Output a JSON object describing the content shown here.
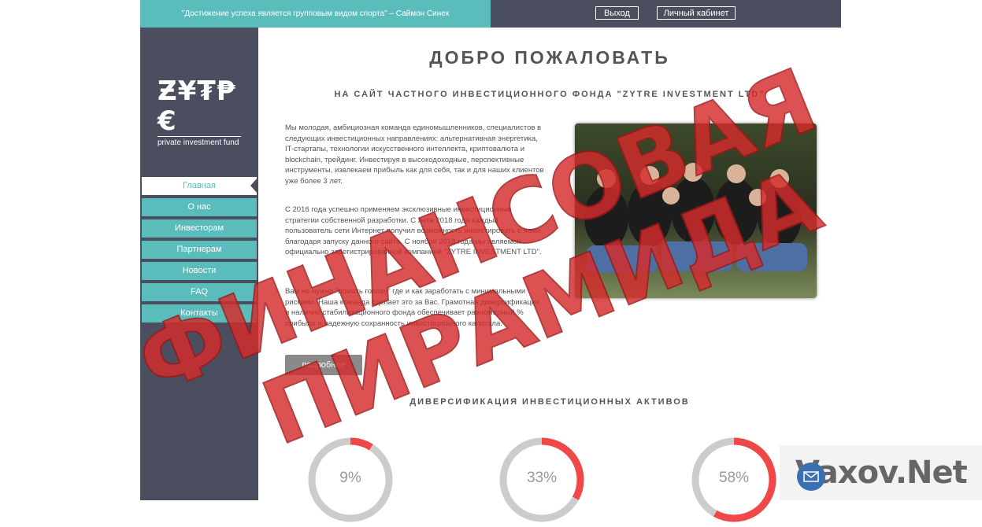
{
  "topbar": {
    "quote": "\"Достижение успеха является групповым видом спорта\" – Саймон Синек",
    "logout_label": "Выход",
    "cabinet_label": "Личный кабинет"
  },
  "logo": {
    "main": "ZYTRE",
    "sub": "private investment fund"
  },
  "nav": [
    {
      "label": "Главная"
    },
    {
      "label": "О нас"
    },
    {
      "label": "Инвесторам"
    },
    {
      "label": "Партнерам"
    },
    {
      "label": "Новости"
    },
    {
      "label": "FAQ"
    },
    {
      "label": "Контакты"
    }
  ],
  "main": {
    "title": "ДОБРО ПОЖАЛОВАТЬ",
    "subtitle": "НА САЙТ ЧАСТНОГО ИНВЕСТИЦИОННОГО ФОНДА \"ZYTRE INVESTMENT LTD\"",
    "paragraphs": [
      "Мы молодая, амбициозная команда единомышленников, специалистов в следующих инвестиционных направлениях: альтернативная энергетика, IT-стартапы, технологии искусственного интеллекта, криптовалюта и blockchain, трейдинг. Инвестируя в высокодоходные, перспективные инструменты, извлекаем прибыль как для себя, так и для наших клиентов уже более 3 лет.",
      "С 2016 года успешно применяем эксклюзивные инвестиционные стратегии собственной разработки. С лета 2018 года каждый пользователь сети Интернет получил возможность инвестировать с нами, благодаря запуску данного сайта. С ноября 2018 года мы являемся официально зарегистрированной компанией \"ZYTRE INVESTMENT LTD\".",
      "Вам не нужно \"ломать голову\" где и как заработать с минимальными рисками. Наша команда сделает это за Вас. Грамотная диверсификация и наличие стабилизационного фонда обеспечивает равномерный % прибыли и надежную сохранность инвестиционного капитала."
    ],
    "more_label": "подробнее",
    "diversification_title": "ДИВЕРСИФИКАЦИЯ ИНВЕСТИЦИОННЫХ АКТИВОВ",
    "assets": [
      {
        "label": "9%",
        "value": 9
      },
      {
        "label": "33%",
        "value": 33
      },
      {
        "label": "58%",
        "value": 58
      }
    ]
  },
  "overlay": {
    "stamp_line1": "ФИНАНСОВАЯ",
    "stamp_line2": "ПИРАМИДА",
    "watermark": "Vaxov.Net"
  },
  "colors": {
    "teal": "#5bbcbc",
    "dark": "#4a4e5e",
    "ring_red": "#f04848",
    "ring_grey": "#cccccc",
    "stamp": "#d52b2b"
  }
}
